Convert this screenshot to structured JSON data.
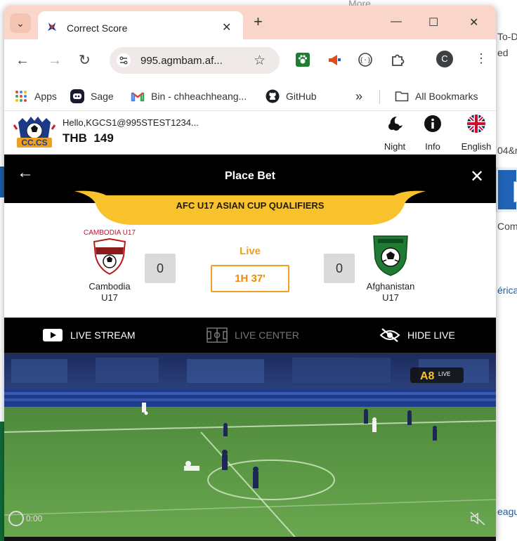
{
  "background": {
    "top_text": "More",
    "right_texts": [
      "To-D",
      "ed",
      "04&r",
      "Com",
      "érica",
      "eagu"
    ]
  },
  "browser": {
    "tab_title": "Correct Score",
    "url": "995.agmbam.af...",
    "profile_initial": "C",
    "bookmarks": [
      {
        "label": "Apps",
        "icon": "apps-grid-icon"
      },
      {
        "label": "Sage",
        "icon": "sage-icon"
      },
      {
        "label": "Bin - chheachheang...",
        "icon": "gmail-icon"
      },
      {
        "label": "GitHub",
        "icon": "github-icon"
      }
    ],
    "bookmarks_overflow": "»",
    "all_bookmarks": "All Bookmarks"
  },
  "site": {
    "greeting": "Hello,KGCS1@995STEST1234...",
    "currency": "THB",
    "balance": "149",
    "header_buttons": [
      {
        "label": "Night",
        "icon": "moon-icon"
      },
      {
        "label": "Info",
        "icon": "info-icon"
      },
      {
        "label": "English",
        "icon": "uk-flag-icon"
      }
    ]
  },
  "place_bet": {
    "title": "Place Bet",
    "competition": "AFC U17 ASIAN CUP QUALIFIERS"
  },
  "match": {
    "status": "Live",
    "time": "1H 37'",
    "home": {
      "name_line1": "Cambodia",
      "name_line2": "U17",
      "crest_text": "CAMBODIA U17",
      "score": "0"
    },
    "away": {
      "name_line1": "Afghanistan",
      "name_line2": "U17",
      "score": "0"
    }
  },
  "live_bar": {
    "stream": "LIVE STREAM",
    "center": "LIVE CENTER",
    "hide": "HIDE LIVE"
  },
  "video": {
    "time": "0:00",
    "watermark_line1": "A8",
    "watermark_line2": "LIVE"
  },
  "colors": {
    "accent_orange": "#f0a020",
    "banner_gold": "#f7c22b",
    "tab_bar": "#f9d6c9"
  }
}
